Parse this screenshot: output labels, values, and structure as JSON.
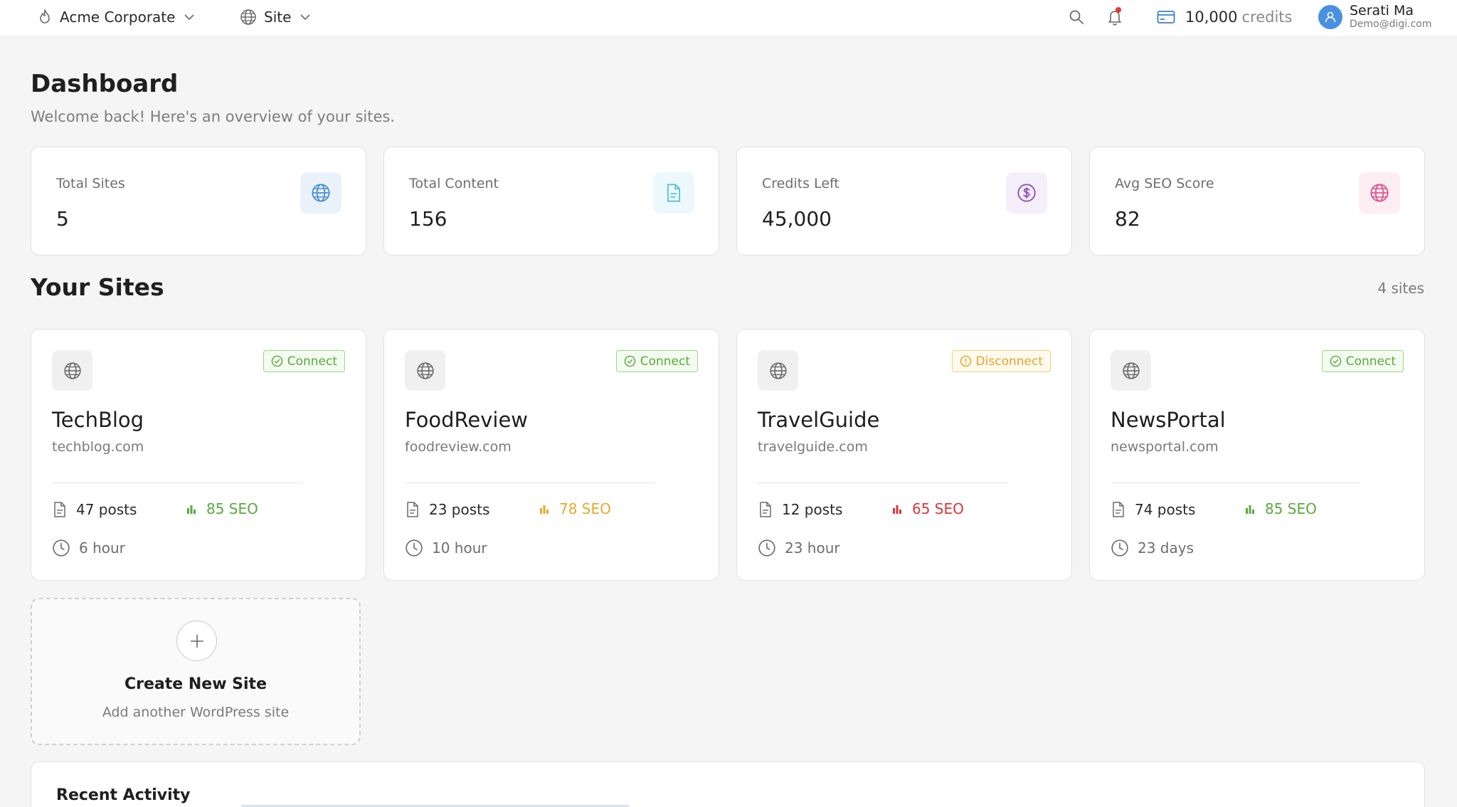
{
  "topbar": {
    "org_name": "Acme Corporate",
    "site_selector": "Site",
    "credits_amount": "10,000",
    "credits_unit": "credits",
    "user_name": "Serati Ma",
    "user_email": "Demo@digi.com"
  },
  "header": {
    "title": "Dashboard",
    "subtitle": "Welcome back! Here's an overview of your sites."
  },
  "stats": [
    {
      "label": "Total Sites",
      "value": "5",
      "icon": "globe-icon",
      "color": "#4a8fd4",
      "bg": "#e9f2fb"
    },
    {
      "label": "Total Content",
      "value": "156",
      "icon": "document-icon",
      "color": "#5bbfd6",
      "bg": "#ecf9fc"
    },
    {
      "label": "Credits Left",
      "value": "45,000",
      "icon": "dollar-icon",
      "color": "#8a4fc2",
      "bg": "#f5eefb"
    },
    {
      "label": "Avg SEO Score",
      "value": "82",
      "icon": "globe-icon",
      "color": "#e0558e",
      "bg": "#fdeef4"
    }
  ],
  "sites_section": {
    "title": "Your Sites",
    "count_label": "4 sites"
  },
  "sites": [
    {
      "name": "TechBlog",
      "domain": "techblog.com",
      "status": "Connect",
      "status_type": "ok",
      "posts": "47 posts",
      "seo": "85 SEO",
      "seo_color": "#5aa93c",
      "time": "6 hour"
    },
    {
      "name": "FoodReview",
      "domain": "foodreview.com",
      "status": "Connect",
      "status_type": "ok",
      "posts": "23 posts",
      "seo": "78 SEO",
      "seo_color": "#e8a82a",
      "time": "10 hour"
    },
    {
      "name": "TravelGuide",
      "domain": "travelguide.com",
      "status": "Disconnect",
      "status_type": "warn",
      "posts": "12 posts",
      "seo": "65 SEO",
      "seo_color": "#d9363a",
      "time": "23 hour"
    },
    {
      "name": "NewsPortal",
      "domain": "newsportal.com",
      "status": "Connect",
      "status_type": "ok",
      "posts": "74 posts",
      "seo": "85 SEO",
      "seo_color": "#5aa93c",
      "time": "23 days"
    }
  ],
  "create_card": {
    "title": "Create New Site",
    "subtitle": "Add another WordPress site"
  },
  "activity": {
    "title": "Recent Activity"
  }
}
